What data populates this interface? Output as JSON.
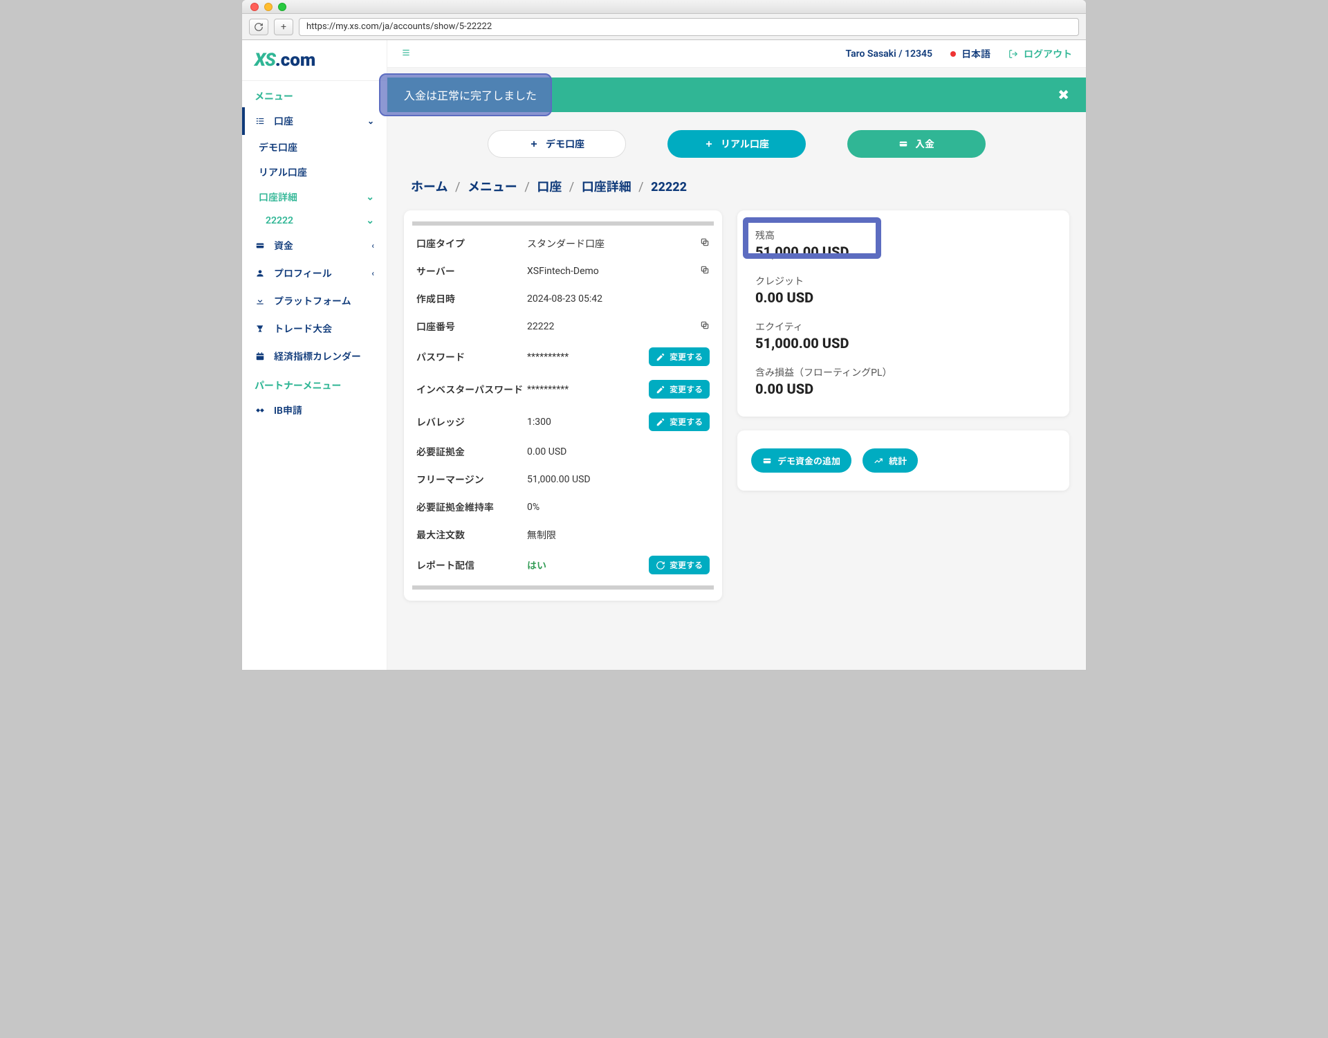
{
  "browser": {
    "url": "https://my.xs.com/ja/accounts/show/5-22222"
  },
  "logo": {
    "xs": "XS",
    "com": ".com"
  },
  "sidebar": {
    "menu_title": "メニュー",
    "accounts": "口座",
    "demo_account": "デモ口座",
    "real_account": "リアル口座",
    "account_details": "口座詳細",
    "account_number": "22222",
    "funds": "資金",
    "profile": "プロフィール",
    "platform": "プラットフォーム",
    "trade_comp": "トレード大会",
    "econ_calendar": "経済指標カレンダー",
    "partner_title": "パートナーメニュー",
    "ib_apply": "IB申請"
  },
  "topbar": {
    "user": "Taro Sasaki / 12345",
    "language": "日本語",
    "logout": "ログアウト"
  },
  "banner": {
    "text": "入金は正常に完了しました"
  },
  "actions": {
    "demo": "デモ口座",
    "real": "リアル口座",
    "deposit": "入金"
  },
  "breadcrumb": {
    "home": "ホーム",
    "menu": "メニュー",
    "accounts": "口座",
    "details": "口座詳細",
    "current": "22222"
  },
  "details": {
    "type_label": "口座タイプ",
    "type_value": "スタンダード口座",
    "server_label": "サーバー",
    "server_value": "XSFintech-Demo",
    "created_label": "作成日時",
    "created_value": "2024-08-23 05:42",
    "number_label": "口座番号",
    "number_value": "22222",
    "password_label": "パスワード",
    "password_value": "**********",
    "investor_label": "インベスターパスワード",
    "investor_value": "**********",
    "leverage_label": "レバレッジ",
    "leverage_value": "1:300",
    "margin_label": "必要証拠金",
    "margin_value": "0.00 USD",
    "free_margin_label": "フリーマージン",
    "free_margin_value": "51,000.00 USD",
    "margin_level_label": "必要証拠金維持率",
    "margin_level_value": "0%",
    "max_orders_label": "最大注文数",
    "max_orders_value": "無制限",
    "report_label": "レポート配信",
    "report_value": "はい",
    "change_btn": "変更する"
  },
  "balances": {
    "balance_label": "残高",
    "balance_value": "51,000.00 USD",
    "credit_label": "クレジット",
    "credit_value": "0.00 USD",
    "equity_label": "エクイティ",
    "equity_value": "51,000.00 USD",
    "floating_label": "含み損益（フローティングPL）",
    "floating_value": "0.00 USD"
  },
  "account_actions": {
    "add_demo_funds": "デモ資金の追加",
    "stats": "統計"
  }
}
